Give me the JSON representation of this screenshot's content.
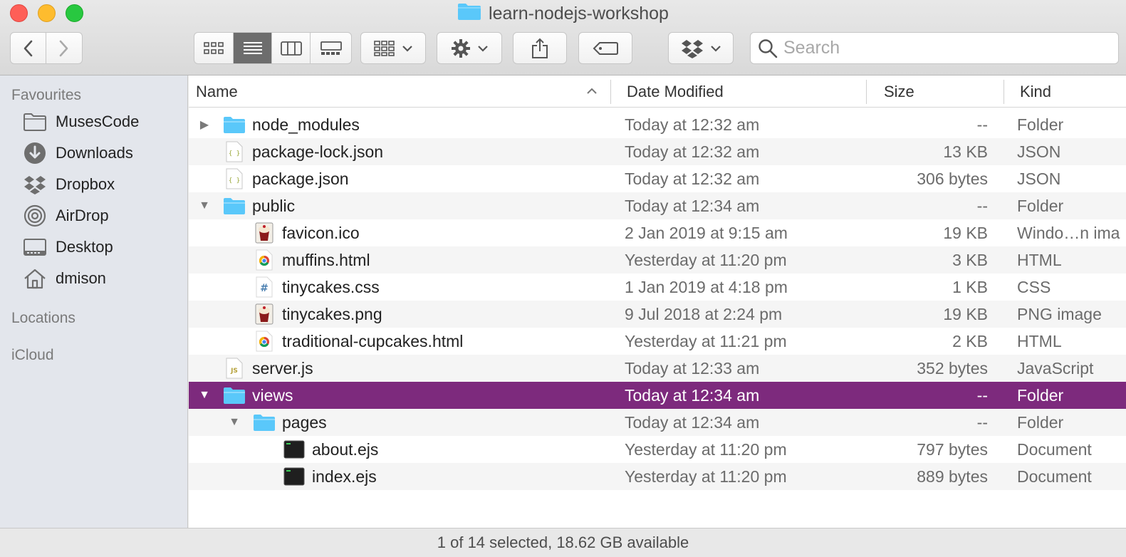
{
  "window": {
    "title": "learn-nodejs-workshop"
  },
  "toolbar": {
    "search_placeholder": "Search",
    "views": [
      "icon-view",
      "list-view",
      "column-view",
      "gallery-view"
    ],
    "active_view": "list-view"
  },
  "sidebar": {
    "favourites_heading": "Favourites",
    "items": [
      {
        "label": "MusesCode",
        "icon": "folder-icon"
      },
      {
        "label": "Downloads",
        "icon": "downloads-icon"
      },
      {
        "label": "Dropbox",
        "icon": "dropbox-icon"
      },
      {
        "label": "AirDrop",
        "icon": "airdrop-icon"
      },
      {
        "label": "Desktop",
        "icon": "desktop-icon"
      },
      {
        "label": "dmison",
        "icon": "home-icon"
      }
    ],
    "locations_heading": "Locations",
    "icloud_heading": "iCloud"
  },
  "columns": {
    "name": "Name",
    "date": "Date Modified",
    "size": "Size",
    "kind": "Kind"
  },
  "files": [
    {
      "name": "node_modules",
      "date": "Today at 12:32 am",
      "size": "--",
      "kind": "Folder",
      "icon": "folder-icon",
      "depth": 0,
      "disclosure": "collapsed"
    },
    {
      "name": "package-lock.json",
      "date": "Today at 12:32 am",
      "size": "13 KB",
      "kind": "JSON",
      "icon": "json-file-icon",
      "depth": 0,
      "disclosure": "none"
    },
    {
      "name": "package.json",
      "date": "Today at 12:32 am",
      "size": "306 bytes",
      "kind": "JSON",
      "icon": "json-file-icon",
      "depth": 0,
      "disclosure": "none"
    },
    {
      "name": "public",
      "date": "Today at 12:34 am",
      "size": "--",
      "kind": "Folder",
      "icon": "folder-icon",
      "depth": 0,
      "disclosure": "expanded"
    },
    {
      "name": "favicon.ico",
      "date": "2 Jan 2019 at 9:15 am",
      "size": "19 KB",
      "kind": "Windo…n ima",
      "icon": "image-file-icon",
      "depth": 1,
      "disclosure": "none"
    },
    {
      "name": "muffins.html",
      "date": "Yesterday at 11:20 pm",
      "size": "3 KB",
      "kind": "HTML",
      "icon": "chrome-html-icon",
      "depth": 1,
      "disclosure": "none"
    },
    {
      "name": "tinycakes.css",
      "date": "1 Jan 2019 at 4:18 pm",
      "size": "1 KB",
      "kind": "CSS",
      "icon": "css-file-icon",
      "depth": 1,
      "disclosure": "none"
    },
    {
      "name": "tinycakes.png",
      "date": "9 Jul 2018 at 2:24 pm",
      "size": "19 KB",
      "kind": "PNG image",
      "icon": "image-file-icon",
      "depth": 1,
      "disclosure": "none"
    },
    {
      "name": "traditional-cupcakes.html",
      "date": "Yesterday at 11:21 pm",
      "size": "2 KB",
      "kind": "HTML",
      "icon": "chrome-html-icon",
      "depth": 1,
      "disclosure": "none"
    },
    {
      "name": "server.js",
      "date": "Today at 12:33 am",
      "size": "352 bytes",
      "kind": "JavaScript",
      "icon": "js-file-icon",
      "depth": 0,
      "disclosure": "none"
    },
    {
      "name": "views",
      "date": "Today at 12:34 am",
      "size": "--",
      "kind": "Folder",
      "icon": "folder-icon",
      "depth": 0,
      "disclosure": "expanded",
      "selected": true
    },
    {
      "name": "pages",
      "date": "Today at 12:34 am",
      "size": "--",
      "kind": "Folder",
      "icon": "folder-icon",
      "depth": 1,
      "disclosure": "expanded"
    },
    {
      "name": "about.ejs",
      "date": "Yesterday at 11:20 pm",
      "size": "797 bytes",
      "kind": "Document",
      "icon": "terminal-document-icon",
      "depth": 2,
      "disclosure": "none"
    },
    {
      "name": "index.ejs",
      "date": "Yesterday at 11:20 pm",
      "size": "889 bytes",
      "kind": "Document",
      "icon": "terminal-document-icon",
      "depth": 2,
      "disclosure": "none"
    }
  ],
  "status": {
    "text": "1 of 14 selected, 18.62 GB available"
  },
  "colors": {
    "selection": "#7d2a7d",
    "folder": "#5ac8fa"
  }
}
